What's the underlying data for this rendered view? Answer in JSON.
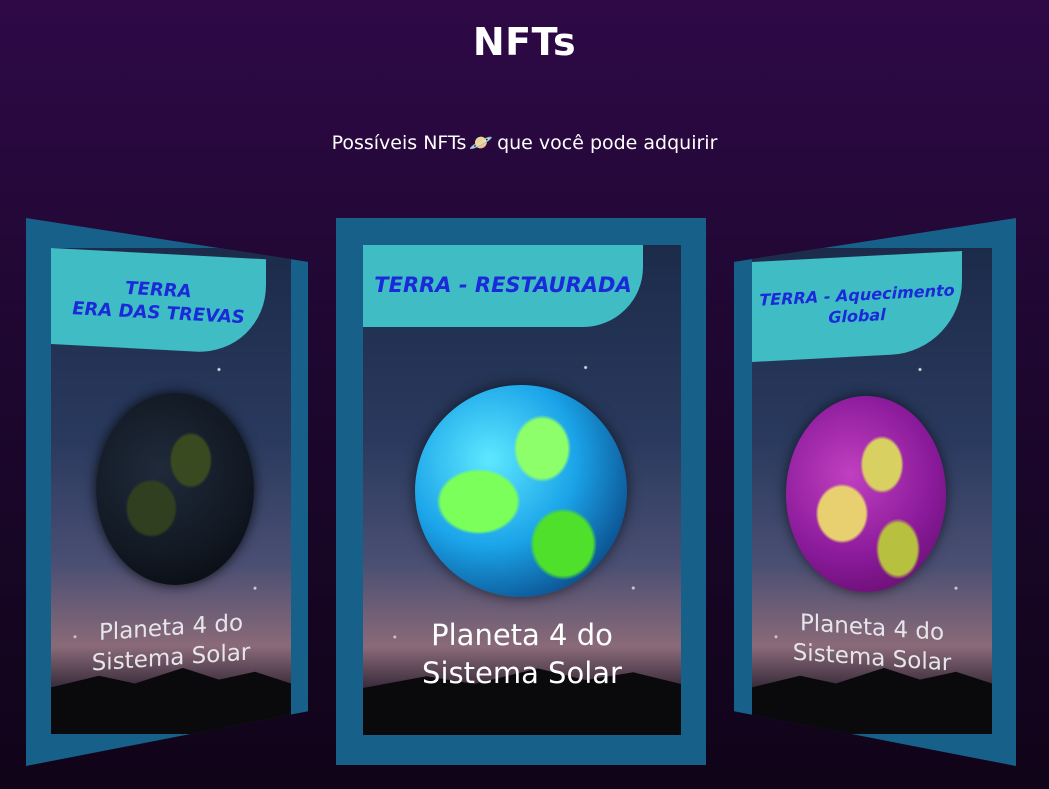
{
  "header": {
    "title": "NFTs",
    "subtitle_before": "Possíveis NFTs",
    "subtitle_emoji": "🪐",
    "subtitle_after": "que você pode adquirir"
  },
  "cards": [
    {
      "banner_line1": "TERRA",
      "banner_line2": "ERA DAS TREVAS",
      "caption_line1": "Planeta 4 do",
      "caption_line2": "Sistema Solar"
    },
    {
      "banner_line1": "TERRA - RESTAURADA",
      "caption_line1": "Planeta 4 do",
      "caption_line2": "Sistema Solar"
    },
    {
      "banner_line1": "TERRA - Aquecimento",
      "banner_line2": "Global",
      "caption_line1": "Planeta 4 do",
      "caption_line2": "Sistema Solar"
    }
  ],
  "colors": {
    "card_frame": "#17608a",
    "banner_bg": "#40bcc4",
    "banner_text": "#1b2ad8",
    "page_bg_top": "#2e0946",
    "page_bg_bottom": "#100418"
  }
}
